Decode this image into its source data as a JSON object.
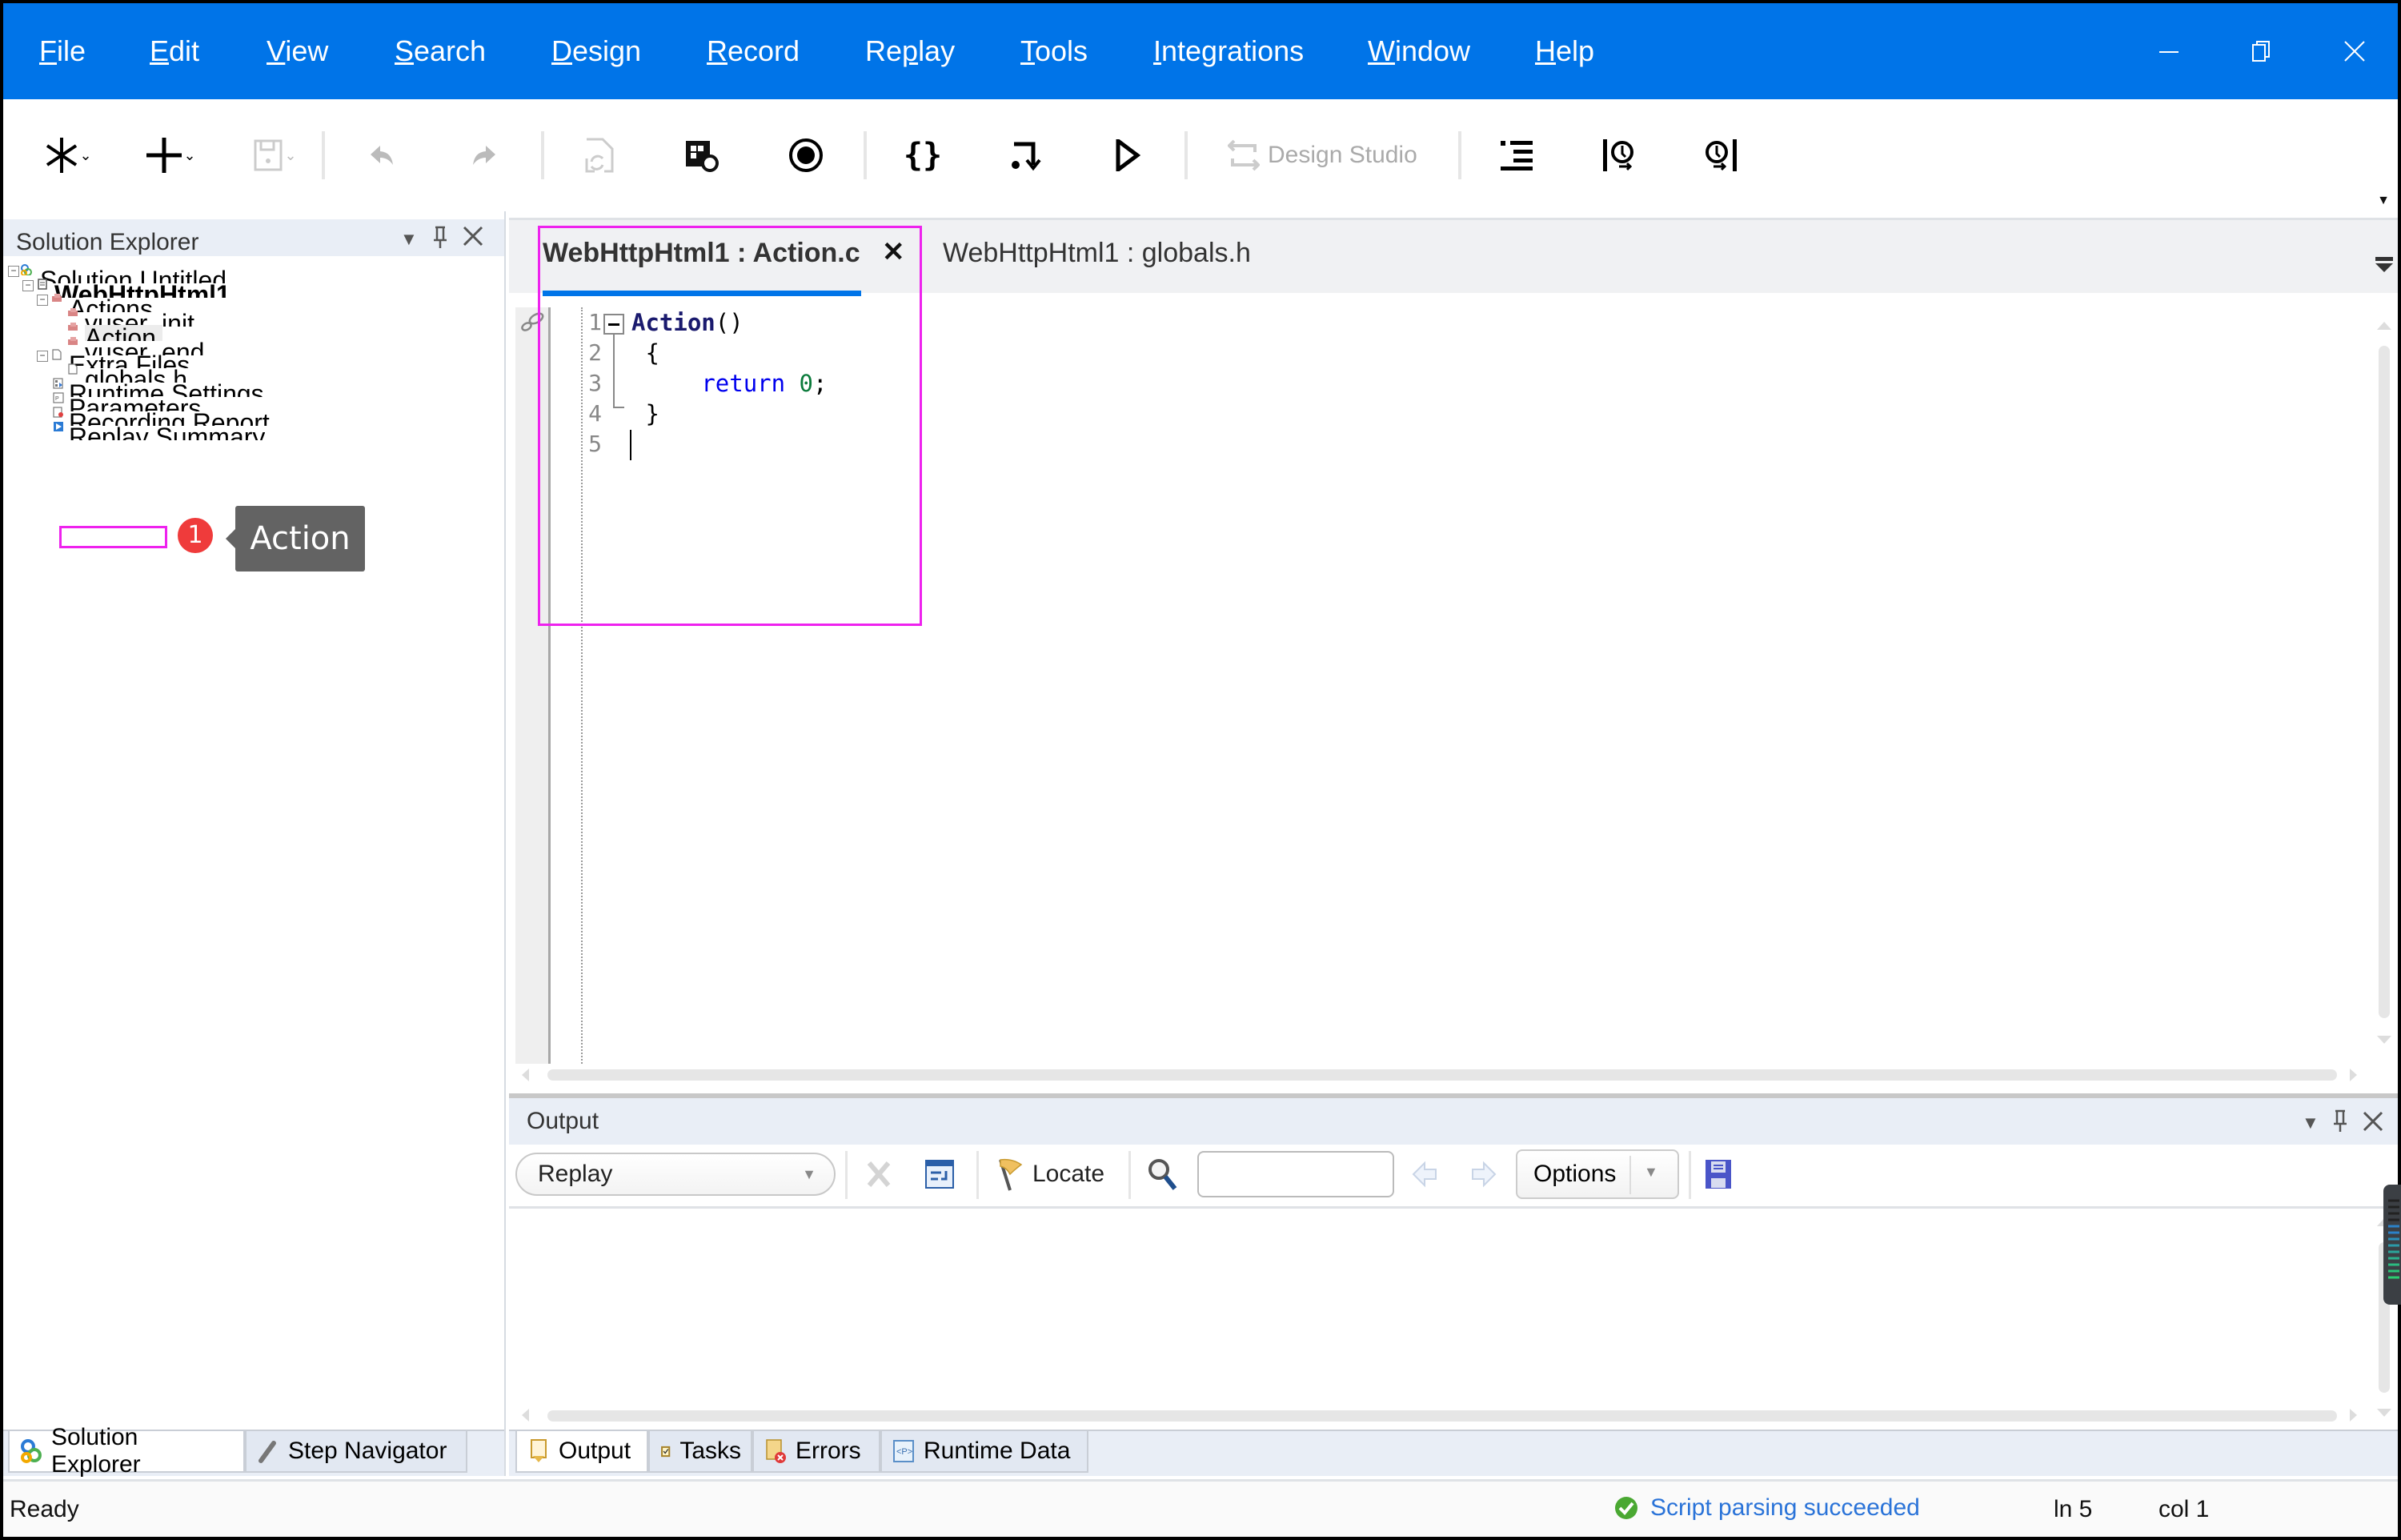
{
  "menubar": {
    "items": [
      {
        "label": "File",
        "accel": "F"
      },
      {
        "label": "Edit",
        "accel": "E"
      },
      {
        "label": "View",
        "accel": "V"
      },
      {
        "label": "Search",
        "accel": "S"
      },
      {
        "label": "Design",
        "accel": "D"
      },
      {
        "label": "Record",
        "accel": "R"
      },
      {
        "label": "Replay",
        "accel": "p"
      },
      {
        "label": "Tools",
        "accel": "T"
      },
      {
        "label": "Integrations",
        "accel": "I"
      },
      {
        "label": "Window",
        "accel": "W"
      },
      {
        "label": "Help",
        "accel": "H"
      }
    ],
    "window_controls": [
      "minimize",
      "restore",
      "close"
    ],
    "accent_color": "#0074e8"
  },
  "toolbar": {
    "buttons": [
      {
        "icon": "new-solution-icon",
        "has_dropdown": true,
        "enabled": true
      },
      {
        "icon": "add-icon",
        "has_dropdown": true,
        "enabled": true
      },
      {
        "icon": "save-icon",
        "has_dropdown": true,
        "enabled": false
      },
      {
        "icon": "undo-icon",
        "enabled": false
      },
      {
        "icon": "redo-icon",
        "enabled": false
      },
      {
        "icon": "regenerate-icon",
        "enabled": false
      },
      {
        "icon": "record-settings-icon",
        "enabled": true
      },
      {
        "icon": "record-icon",
        "enabled": true
      },
      {
        "icon": "braces-icon",
        "enabled": true
      },
      {
        "icon": "step-into-icon",
        "enabled": true
      },
      {
        "icon": "play-icon",
        "enabled": true
      },
      {
        "icon": "design-studio-icon",
        "enabled": false
      },
      {
        "icon": "outline-icon",
        "enabled": true
      },
      {
        "icon": "run-to-start-icon",
        "enabled": true
      },
      {
        "icon": "run-to-end-icon",
        "enabled": true
      }
    ],
    "design_studio_label": "Design Studio"
  },
  "solution_explorer": {
    "title": "Solution Explorer",
    "tree": [
      {
        "label": "Solution Untitled",
        "level": 0,
        "expanded": true,
        "icon": "solution-icon"
      },
      {
        "label": "WebHttpHtml1",
        "level": 1,
        "expanded": true,
        "bold": true,
        "icon": "script-icon"
      },
      {
        "label": "Actions",
        "level": 2,
        "expanded": true,
        "icon": "actions-icon"
      },
      {
        "label": "vuser_init",
        "level": 3,
        "icon": "action-icon"
      },
      {
        "label": "Action",
        "level": 3,
        "icon": "action-icon",
        "highlighted": true
      },
      {
        "label": "vuser_end",
        "level": 3,
        "icon": "action-icon"
      },
      {
        "label": "Extra Files",
        "level": 2,
        "expanded": true,
        "icon": "extra-files-icon"
      },
      {
        "label": "globals.h",
        "level": 3,
        "icon": "file-icon"
      },
      {
        "label": "Runtime Settings",
        "level": 2,
        "icon": "runtime-settings-icon"
      },
      {
        "label": "Parameters",
        "level": 2,
        "icon": "parameters-icon"
      },
      {
        "label": "Recording Report",
        "level": 2,
        "icon": "recording-report-icon"
      },
      {
        "label": "Replay Summary",
        "level": 2,
        "icon": "replay-summary-icon"
      }
    ],
    "bottom_tabs": [
      {
        "label": "Solution Explorer",
        "active": true
      },
      {
        "label": "Step Navigator",
        "active": false
      }
    ]
  },
  "annotation": {
    "step_number": "1",
    "tooltip": "Action",
    "highlight_color": "#ee22ee",
    "badge_color": "#ef3b3b"
  },
  "editor": {
    "tabs": [
      {
        "label": "WebHttpHtml1 : Action.c",
        "active": true,
        "closable": true
      },
      {
        "label": "WebHttpHtml1 : globals.h",
        "active": false
      }
    ],
    "close_glyph": "✕",
    "line_numbers": [
      "1",
      "2",
      "3",
      "4",
      "5"
    ],
    "code": {
      "line1_fn": "Action",
      "line1_rest": "()",
      "line2": " {",
      "line3_kw": "return",
      "line3_num": "0",
      "line3_end": ";",
      "line4": " }",
      "line5": ""
    }
  },
  "output": {
    "title": "Output",
    "source_select": "Replay",
    "locate_label": "Locate",
    "search_value": "",
    "options_label": "Options",
    "bottom_tabs": [
      {
        "label": "Output",
        "active": true
      },
      {
        "label": "Tasks",
        "active": false
      },
      {
        "label": "Errors",
        "active": false
      },
      {
        "label": "Runtime Data",
        "active": false
      }
    ]
  },
  "statusbar": {
    "ready": "Ready",
    "parse_status": "Script parsing succeeded",
    "line": "ln 5",
    "col": "col 1",
    "parse_color": "#2a73d8"
  }
}
